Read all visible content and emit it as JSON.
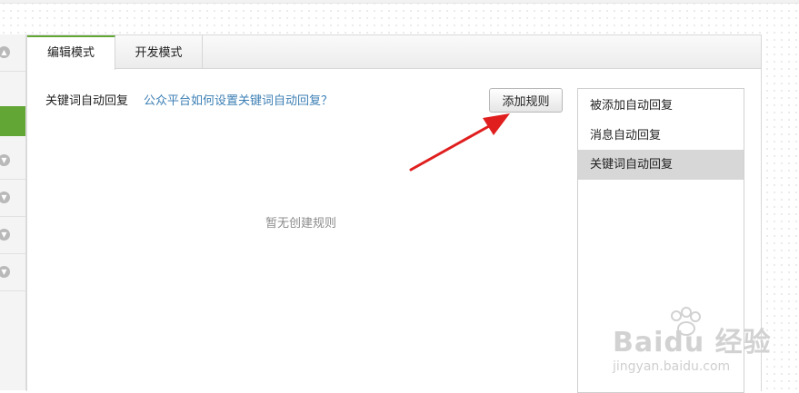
{
  "tabs": [
    {
      "label": "编辑模式",
      "active": true
    },
    {
      "label": "开发模式",
      "active": false
    }
  ],
  "section": {
    "title": "关键词自动回复",
    "help_link": "公众平台如何设置关键词自动回复？"
  },
  "add_button": {
    "label": "添加规则"
  },
  "empty_state": {
    "text": "暂无创建规则"
  },
  "reply_menu": {
    "items": [
      {
        "label": "被添加自动回复",
        "selected": false
      },
      {
        "label": "消息自动回复",
        "selected": false
      },
      {
        "label": "关键词自动回复",
        "selected": true
      }
    ]
  },
  "sidebar": {
    "icons": [
      "chevron-up-icon",
      "chevron-down-icon",
      "chevron-down-icon",
      "chevron-down-icon",
      "chevron-down-icon"
    ]
  },
  "watermark": {
    "logo": "Baidu 经验",
    "url": "jingyan.baidu.com"
  },
  "colors": {
    "accent_green": "#62a636",
    "link_blue": "#3c7fb4",
    "arrow_red": "#e01e1e",
    "selected_gray": "#d7d7d7"
  }
}
